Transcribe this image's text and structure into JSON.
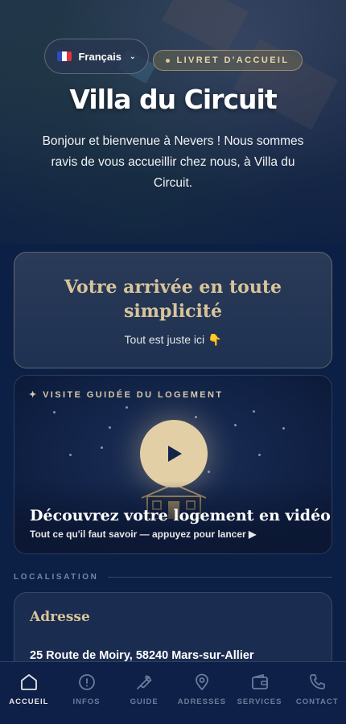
{
  "hero": {
    "language_label": "Français",
    "badge_label": "LIVRET D'ACCUEIL",
    "title": "Villa du Circuit",
    "subtitle": "Bonjour et bienvenue à Nevers ! Nous sommes ravis de vous accueillir chez nous, à Villa du Circuit."
  },
  "welcome_card": {
    "title": "Votre arrivée en toute simplicité",
    "subtitle": "Tout est juste ici 👇"
  },
  "video_card": {
    "label": "✦ VISITE GUIDÉE DU LOGEMENT",
    "title": "Découvrez votre logement en vidéo",
    "subtitle": "Tout ce qu'il faut savoir — appuyez pour lancer ▶"
  },
  "location": {
    "section_label": "LOCALISATION",
    "card_title": "Adresse",
    "address": "25 Route de Moiry, 58240 Mars-sur-Allier"
  },
  "bottom_nav": {
    "items": [
      {
        "label": "ACCUEIL",
        "icon": "home-icon",
        "active": true
      },
      {
        "label": "INFOS",
        "icon": "info-icon",
        "active": false
      },
      {
        "label": "GUIDE",
        "icon": "wrench-icon",
        "active": false
      },
      {
        "label": "ADRESSES",
        "icon": "map-pin-icon",
        "active": false
      },
      {
        "label": "SERVICES",
        "icon": "wallet-icon",
        "active": false
      },
      {
        "label": "CONTACT",
        "icon": "phone-icon",
        "active": false
      }
    ]
  },
  "colors": {
    "background": "#0c1f44",
    "accent_gold": "#d8c49a",
    "play_button": "#e3cfa6",
    "nav_inactive": "#6c7c9c"
  }
}
